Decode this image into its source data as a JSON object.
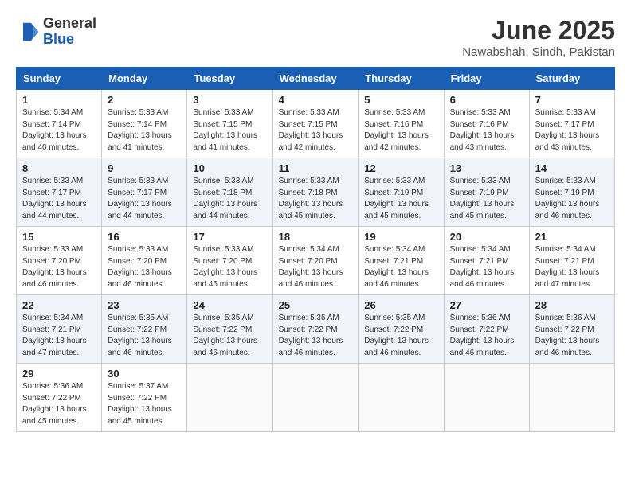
{
  "logo": {
    "general": "General",
    "blue": "Blue"
  },
  "header": {
    "month": "June 2025",
    "location": "Nawabshah, Sindh, Pakistan"
  },
  "days_of_week": [
    "Sunday",
    "Monday",
    "Tuesday",
    "Wednesday",
    "Thursday",
    "Friday",
    "Saturday"
  ],
  "weeks": [
    [
      {
        "day": 1,
        "info": "Sunrise: 5:34 AM\nSunset: 7:14 PM\nDaylight: 13 hours\nand 40 minutes."
      },
      {
        "day": 2,
        "info": "Sunrise: 5:33 AM\nSunset: 7:14 PM\nDaylight: 13 hours\nand 41 minutes."
      },
      {
        "day": 3,
        "info": "Sunrise: 5:33 AM\nSunset: 7:15 PM\nDaylight: 13 hours\nand 41 minutes."
      },
      {
        "day": 4,
        "info": "Sunrise: 5:33 AM\nSunset: 7:15 PM\nDaylight: 13 hours\nand 42 minutes."
      },
      {
        "day": 5,
        "info": "Sunrise: 5:33 AM\nSunset: 7:16 PM\nDaylight: 13 hours\nand 42 minutes."
      },
      {
        "day": 6,
        "info": "Sunrise: 5:33 AM\nSunset: 7:16 PM\nDaylight: 13 hours\nand 43 minutes."
      },
      {
        "day": 7,
        "info": "Sunrise: 5:33 AM\nSunset: 7:17 PM\nDaylight: 13 hours\nand 43 minutes."
      }
    ],
    [
      {
        "day": 8,
        "info": "Sunrise: 5:33 AM\nSunset: 7:17 PM\nDaylight: 13 hours\nand 44 minutes."
      },
      {
        "day": 9,
        "info": "Sunrise: 5:33 AM\nSunset: 7:17 PM\nDaylight: 13 hours\nand 44 minutes."
      },
      {
        "day": 10,
        "info": "Sunrise: 5:33 AM\nSunset: 7:18 PM\nDaylight: 13 hours\nand 44 minutes."
      },
      {
        "day": 11,
        "info": "Sunrise: 5:33 AM\nSunset: 7:18 PM\nDaylight: 13 hours\nand 45 minutes."
      },
      {
        "day": 12,
        "info": "Sunrise: 5:33 AM\nSunset: 7:19 PM\nDaylight: 13 hours\nand 45 minutes."
      },
      {
        "day": 13,
        "info": "Sunrise: 5:33 AM\nSunset: 7:19 PM\nDaylight: 13 hours\nand 45 minutes."
      },
      {
        "day": 14,
        "info": "Sunrise: 5:33 AM\nSunset: 7:19 PM\nDaylight: 13 hours\nand 46 minutes."
      }
    ],
    [
      {
        "day": 15,
        "info": "Sunrise: 5:33 AM\nSunset: 7:20 PM\nDaylight: 13 hours\nand 46 minutes."
      },
      {
        "day": 16,
        "info": "Sunrise: 5:33 AM\nSunset: 7:20 PM\nDaylight: 13 hours\nand 46 minutes."
      },
      {
        "day": 17,
        "info": "Sunrise: 5:33 AM\nSunset: 7:20 PM\nDaylight: 13 hours\nand 46 minutes."
      },
      {
        "day": 18,
        "info": "Sunrise: 5:34 AM\nSunset: 7:20 PM\nDaylight: 13 hours\nand 46 minutes."
      },
      {
        "day": 19,
        "info": "Sunrise: 5:34 AM\nSunset: 7:21 PM\nDaylight: 13 hours\nand 46 minutes."
      },
      {
        "day": 20,
        "info": "Sunrise: 5:34 AM\nSunset: 7:21 PM\nDaylight: 13 hours\nand 46 minutes."
      },
      {
        "day": 21,
        "info": "Sunrise: 5:34 AM\nSunset: 7:21 PM\nDaylight: 13 hours\nand 47 minutes."
      }
    ],
    [
      {
        "day": 22,
        "info": "Sunrise: 5:34 AM\nSunset: 7:21 PM\nDaylight: 13 hours\nand 47 minutes."
      },
      {
        "day": 23,
        "info": "Sunrise: 5:35 AM\nSunset: 7:22 PM\nDaylight: 13 hours\nand 46 minutes."
      },
      {
        "day": 24,
        "info": "Sunrise: 5:35 AM\nSunset: 7:22 PM\nDaylight: 13 hours\nand 46 minutes."
      },
      {
        "day": 25,
        "info": "Sunrise: 5:35 AM\nSunset: 7:22 PM\nDaylight: 13 hours\nand 46 minutes."
      },
      {
        "day": 26,
        "info": "Sunrise: 5:35 AM\nSunset: 7:22 PM\nDaylight: 13 hours\nand 46 minutes."
      },
      {
        "day": 27,
        "info": "Sunrise: 5:36 AM\nSunset: 7:22 PM\nDaylight: 13 hours\nand 46 minutes."
      },
      {
        "day": 28,
        "info": "Sunrise: 5:36 AM\nSunset: 7:22 PM\nDaylight: 13 hours\nand 46 minutes."
      }
    ],
    [
      {
        "day": 29,
        "info": "Sunrise: 5:36 AM\nSunset: 7:22 PM\nDaylight: 13 hours\nand 45 minutes."
      },
      {
        "day": 30,
        "info": "Sunrise: 5:37 AM\nSunset: 7:22 PM\nDaylight: 13 hours\nand 45 minutes."
      },
      null,
      null,
      null,
      null,
      null
    ]
  ]
}
